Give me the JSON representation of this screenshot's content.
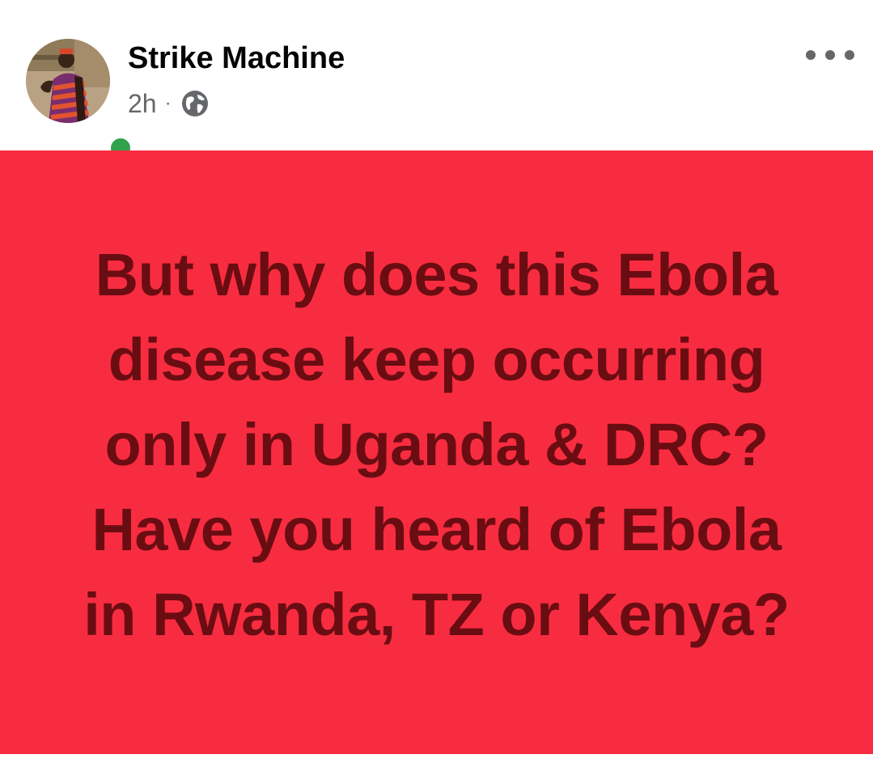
{
  "post": {
    "author": {
      "name": "Strike Machine",
      "avatar_icon": "profile-photo",
      "online": true,
      "online_color": "#31a24c"
    },
    "meta": {
      "time": "2h",
      "separator": "·",
      "audience_icon": "globe-icon"
    },
    "more_icon": "more-horizontal-icon",
    "content": {
      "text": "But why does this Ebola disease keep occurring only in Uganda & DRC? Have you heard of Ebola in Rwanda, TZ or Kenya?",
      "background_color": "#f82c40",
      "text_color": "#6a0d12"
    }
  }
}
